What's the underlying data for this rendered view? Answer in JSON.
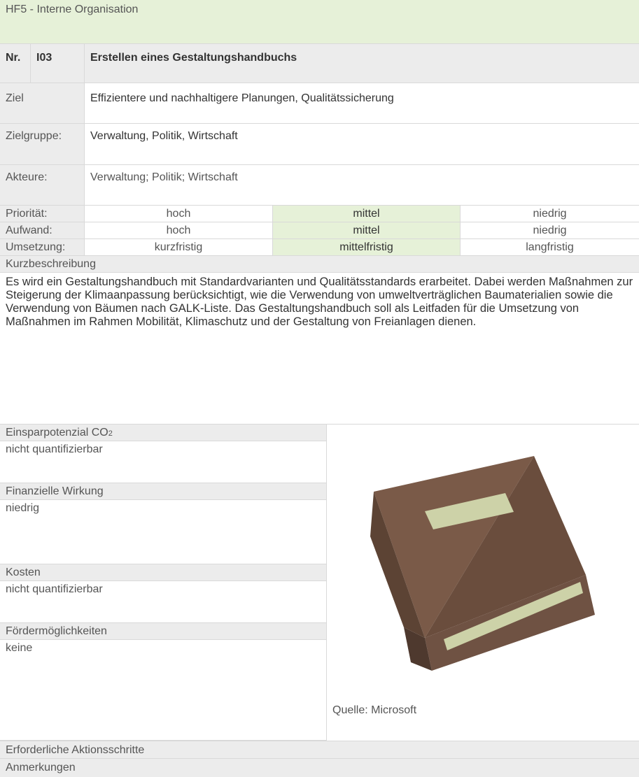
{
  "header": {
    "category": "HF5 - Interne Organisation"
  },
  "measure": {
    "nr_label": "Nr.",
    "nr": "I03",
    "title": "Erstellen eines Gestaltungshandbuchs"
  },
  "fields": {
    "ziel_label": "Ziel",
    "ziel": "Effizientere und nachhaltigere Planungen, Qualitätssicherung",
    "zielgruppe_label": "Zielgruppe:",
    "zielgruppe": "Verwaltung, Politik, Wirtschaft",
    "akteure_label": "Akteure:",
    "akteure": "Verwaltung; Politik; Wirtschaft"
  },
  "ratings": [
    {
      "label": "Priorität:",
      "options": [
        "hoch",
        "mittel",
        "niedrig"
      ],
      "selected": 1
    },
    {
      "label": "Aufwand:",
      "options": [
        "hoch",
        "mittel",
        "niedrig"
      ],
      "selected": 1
    },
    {
      "label": "Umsetzung:",
      "options": [
        "kurzfristig",
        "mittelfristig",
        "langfristig"
      ],
      "selected": 1
    }
  ],
  "description": {
    "label": "Kurzbeschreibung",
    "text": "Es wird ein Gestaltungshandbuch mit Standardvarianten und Qualitätsstandards erarbeitet. Dabei werden Maßnahmen zur Steigerung der Klimaanpassung berücksichtigt, wie die Verwendung von umweltverträglichen Baumaterialien sowie die Verwendung von Bäumen nach GALK-Liste. Das Gestaltungshandbuch soll als Leitfaden für die Umsetzung von Maßnahmen im Rahmen Mobilität, Klimaschutz und der Gestaltung von Freianlagen dienen."
  },
  "sections": {
    "co2_label": "Einsparpotenzial CO",
    "co2_sub": "2",
    "co2": "nicht quantifizierbar",
    "finanz_label": "Finanzielle Wirkung",
    "finanz": "niedrig",
    "kosten_label": "Kosten",
    "kosten": "nicht quantifizierbar",
    "foerder_label": "Fördermöglichkeiten",
    "foerder": "keine"
  },
  "image": {
    "icon": "book-icon",
    "caption": "Quelle: Microsoft"
  },
  "footer": {
    "steps_label": "Erforderliche Aktionsschritte",
    "notes_label": "Anmerkungen"
  },
  "colors": {
    "highlight": "#e6f1d8",
    "label_bg": "#ececec",
    "book": "#7a5a48",
    "book_label": "#cdd2a8"
  }
}
